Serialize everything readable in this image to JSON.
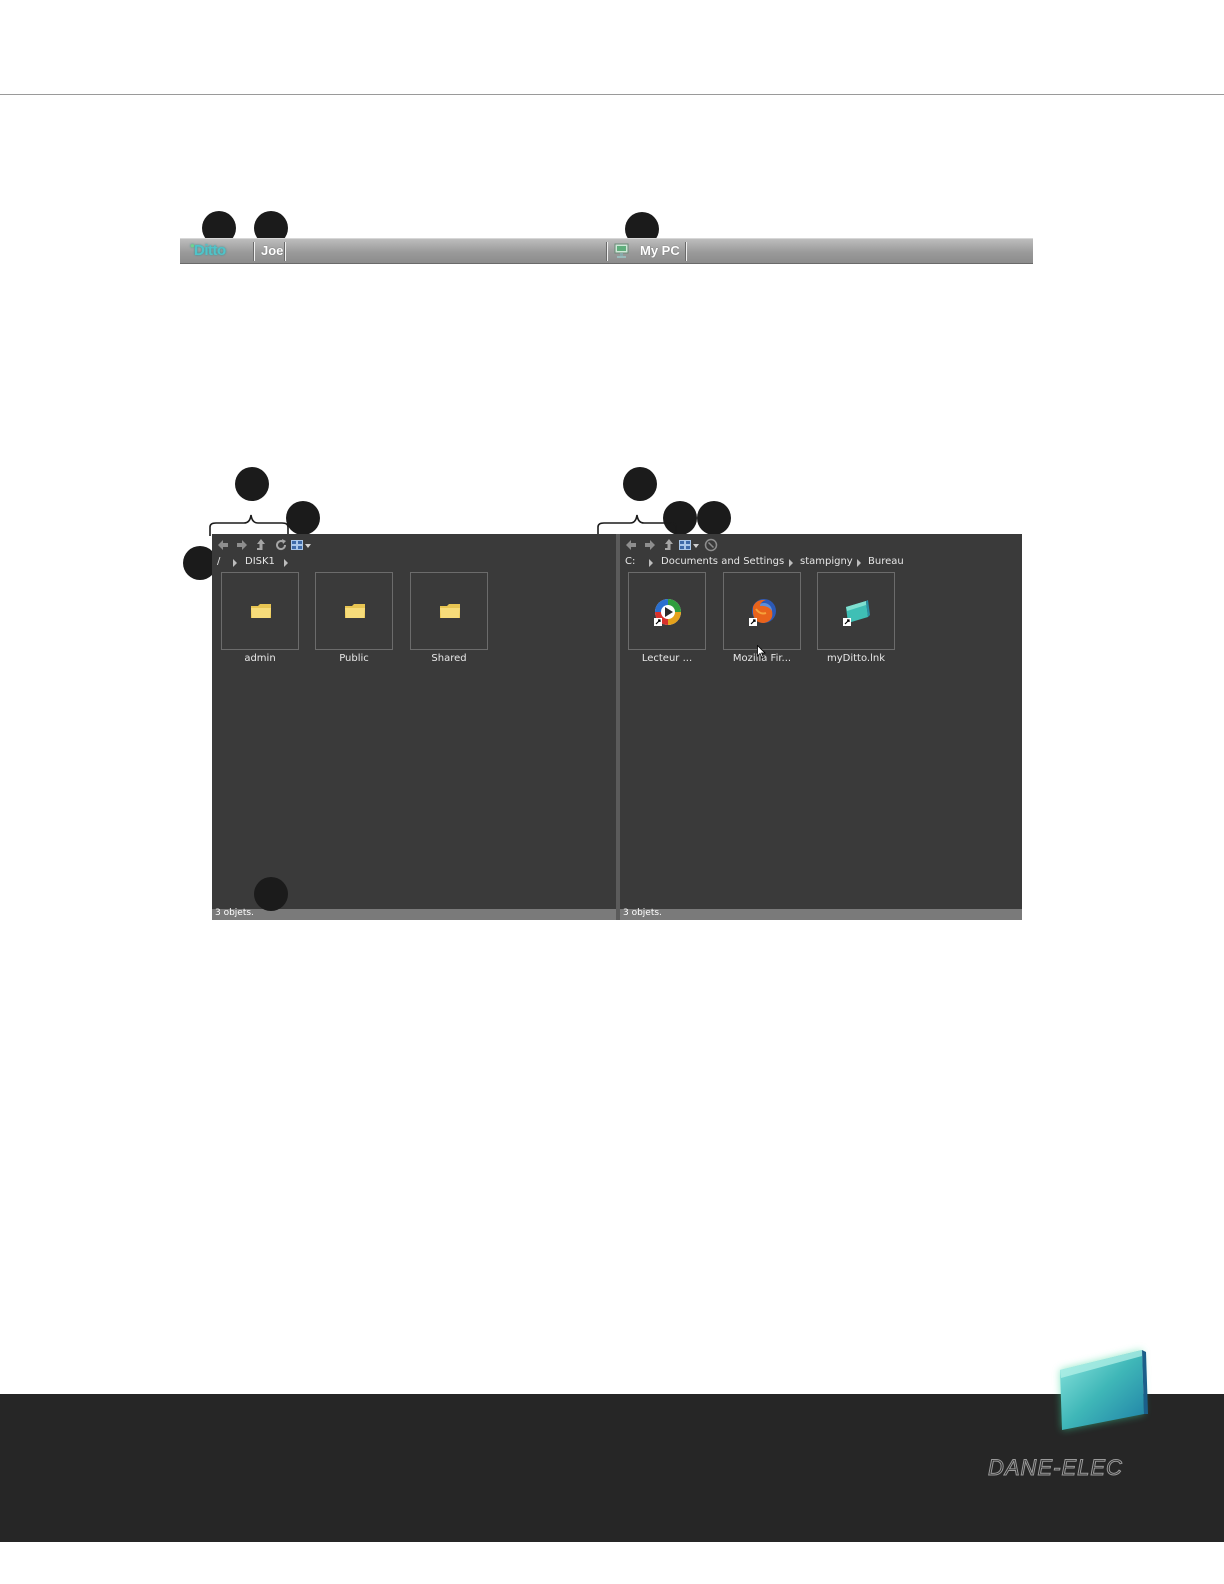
{
  "topbar": {
    "app_logo": "Ditto",
    "user_name": "Joe",
    "computer_label": "My PC"
  },
  "left_pane": {
    "breadcrumbs": [
      "/",
      "DISK1"
    ],
    "items": [
      {
        "label": "admin",
        "icon": "folder-icon"
      },
      {
        "label": "Public",
        "icon": "folder-icon"
      },
      {
        "label": "Shared",
        "icon": "folder-icon"
      }
    ],
    "status": "3 objets."
  },
  "right_pane": {
    "breadcrumbs": [
      "C:",
      "Documents and Settings",
      "stampigny",
      "Bureau"
    ],
    "items": [
      {
        "label": "Lecteur ...",
        "icon": "media-player-shortcut-icon"
      },
      {
        "label": "Mozilla Fir...",
        "icon": "firefox-shortcut-icon"
      },
      {
        "label": "myDitto.lnk",
        "icon": "ditto-shortcut-icon"
      }
    ],
    "status": "3 objets."
  },
  "footer": {
    "brand": "DANE-ELEC"
  },
  "colors": {
    "pane_bg": "#3a3a3a",
    "topbar_bg": "#9a9a9a",
    "footer_bg": "#262626",
    "ditto_accent": "#4fc4c9"
  }
}
